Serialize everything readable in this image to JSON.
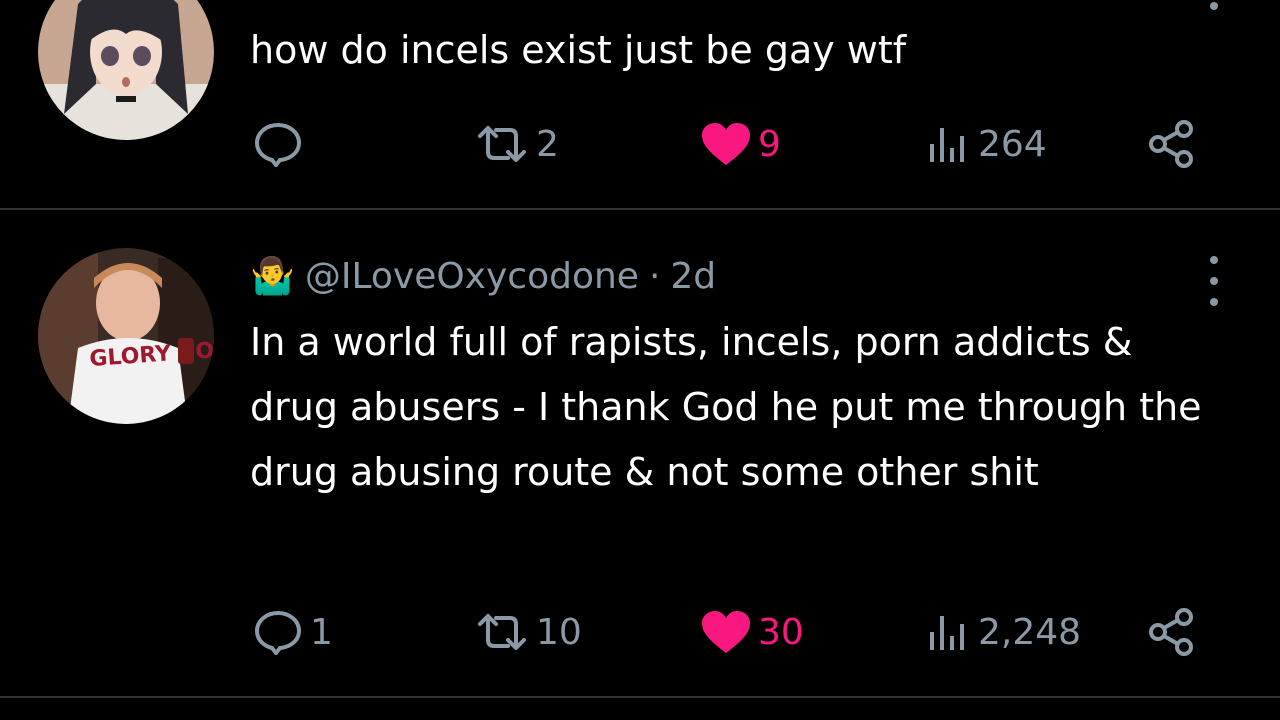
{
  "colors": {
    "background": "#000000",
    "text_primary": "#ffffff",
    "text_secondary": "#8b98a5",
    "like_active": "#f91880",
    "divider": "#2f3336"
  },
  "tweets": [
    {
      "body": "how do incels exist just be gay wtf",
      "avatar_icon": "anime-girl-avatar",
      "actions": {
        "reply_count": "",
        "retweet_count": "2",
        "like_count": "9",
        "liked": true,
        "view_count": "264"
      }
    },
    {
      "emoji": "🤷‍♂️",
      "handle": "@ILoveOxycodone",
      "separator": "·",
      "time": "2d",
      "body": "In a world full of rapists, incels, porn addicts & drug abusers - I thank God he put me through the drug abusing route & not some other shit",
      "avatar_icon": "person-photo-avatar",
      "avatar_shirt_text": "GLORY BOYZ",
      "actions": {
        "reply_count": "1",
        "retweet_count": "10",
        "like_count": "30",
        "liked": true,
        "view_count": "2,248"
      }
    }
  ]
}
